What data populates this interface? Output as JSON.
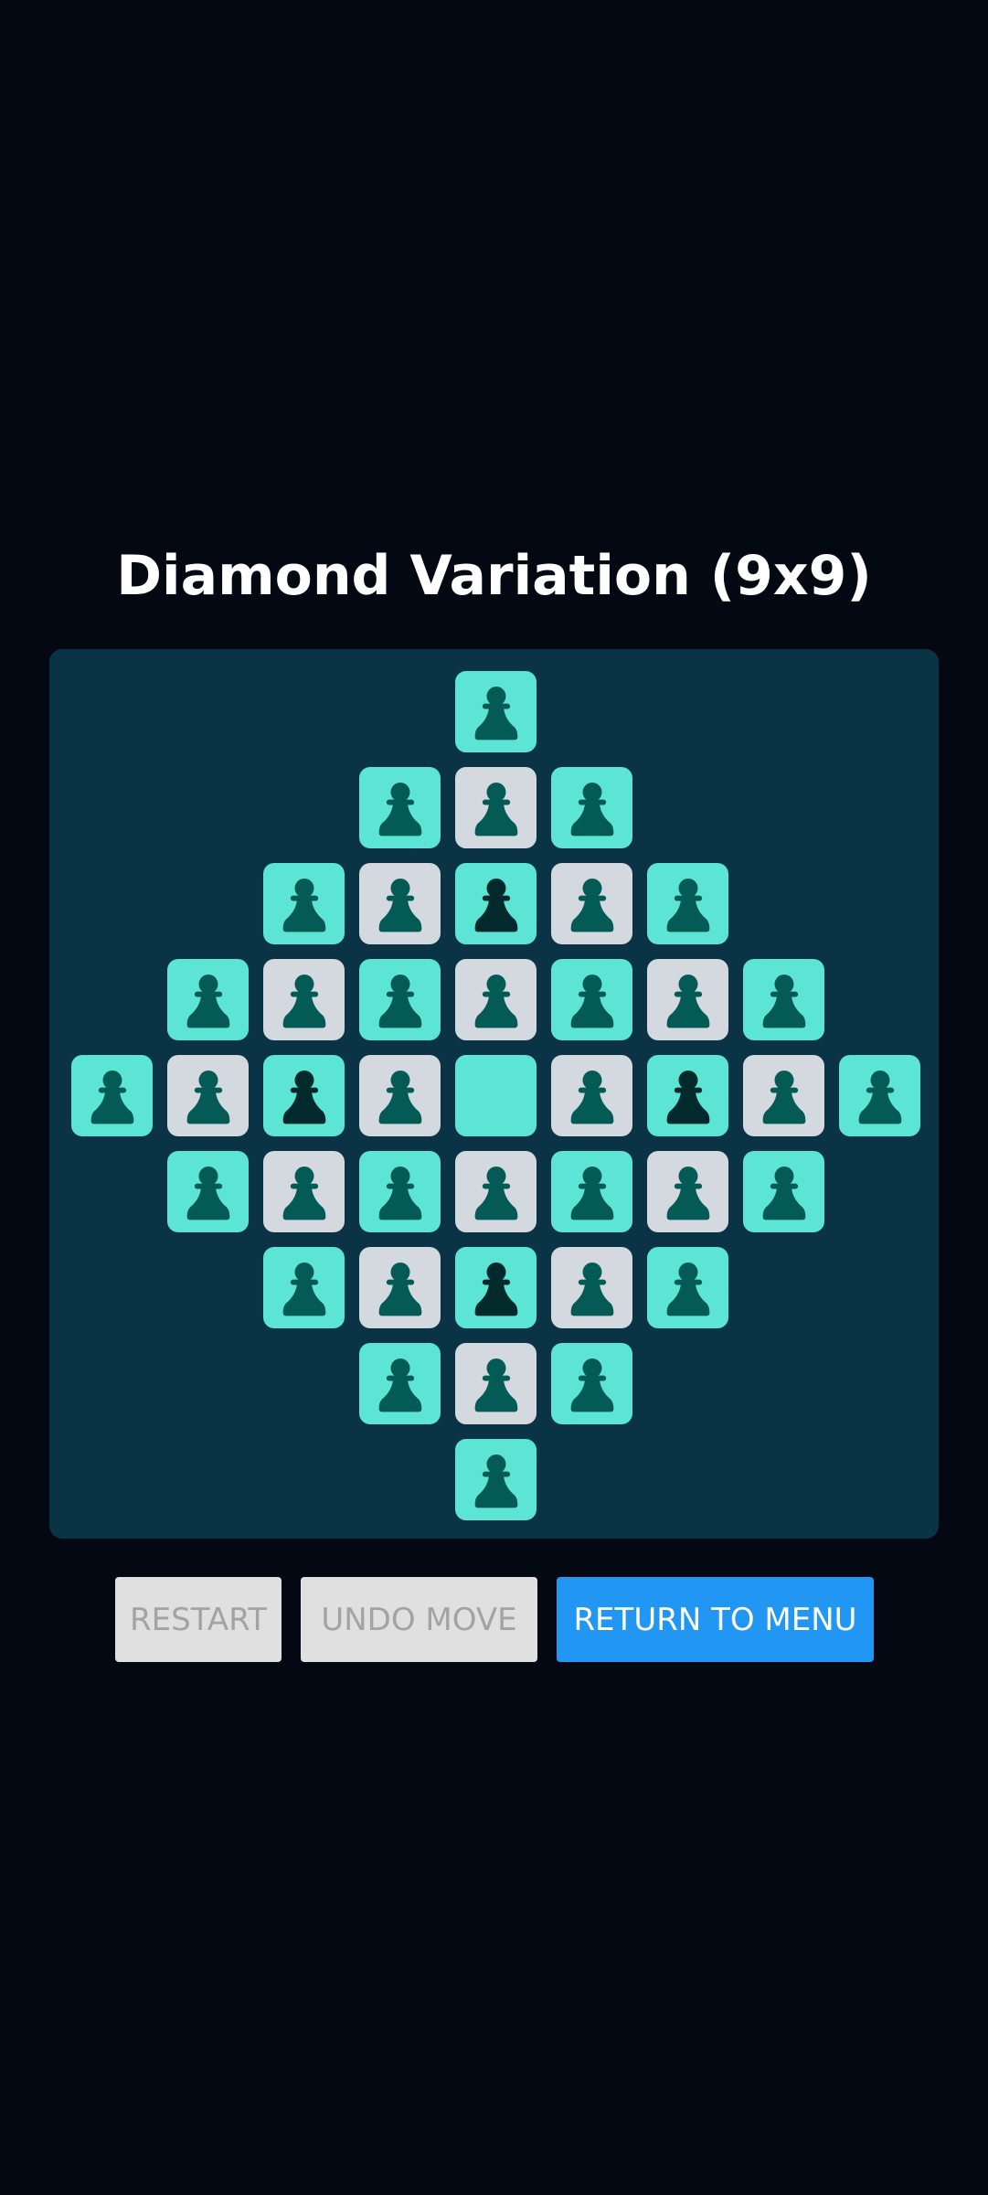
{
  "title": "Diamond Variation (9x9)",
  "board": {
    "size": 9,
    "cells": [
      {
        "row": 0,
        "col": 4,
        "bg": "teal",
        "piece": "normal"
      },
      {
        "row": 1,
        "col": 3,
        "bg": "teal",
        "piece": "normal"
      },
      {
        "row": 1,
        "col": 4,
        "bg": "gray",
        "piece": "normal"
      },
      {
        "row": 1,
        "col": 5,
        "bg": "teal",
        "piece": "normal"
      },
      {
        "row": 2,
        "col": 2,
        "bg": "teal",
        "piece": "normal"
      },
      {
        "row": 2,
        "col": 3,
        "bg": "gray",
        "piece": "normal"
      },
      {
        "row": 2,
        "col": 4,
        "bg": "teal",
        "piece": "dark"
      },
      {
        "row": 2,
        "col": 5,
        "bg": "gray",
        "piece": "normal"
      },
      {
        "row": 2,
        "col": 6,
        "bg": "teal",
        "piece": "normal"
      },
      {
        "row": 3,
        "col": 1,
        "bg": "teal",
        "piece": "normal"
      },
      {
        "row": 3,
        "col": 2,
        "bg": "gray",
        "piece": "normal"
      },
      {
        "row": 3,
        "col": 3,
        "bg": "teal",
        "piece": "normal"
      },
      {
        "row": 3,
        "col": 4,
        "bg": "gray",
        "piece": "normal"
      },
      {
        "row": 3,
        "col": 5,
        "bg": "teal",
        "piece": "normal"
      },
      {
        "row": 3,
        "col": 6,
        "bg": "gray",
        "piece": "normal"
      },
      {
        "row": 3,
        "col": 7,
        "bg": "teal",
        "piece": "normal"
      },
      {
        "row": 4,
        "col": 0,
        "bg": "teal",
        "piece": "normal"
      },
      {
        "row": 4,
        "col": 1,
        "bg": "gray",
        "piece": "normal"
      },
      {
        "row": 4,
        "col": 2,
        "bg": "teal",
        "piece": "dark"
      },
      {
        "row": 4,
        "col": 3,
        "bg": "gray",
        "piece": "normal"
      },
      {
        "row": 4,
        "col": 4,
        "bg": "teal",
        "piece": "none"
      },
      {
        "row": 4,
        "col": 5,
        "bg": "gray",
        "piece": "normal"
      },
      {
        "row": 4,
        "col": 6,
        "bg": "teal",
        "piece": "dark"
      },
      {
        "row": 4,
        "col": 7,
        "bg": "gray",
        "piece": "normal"
      },
      {
        "row": 4,
        "col": 8,
        "bg": "teal",
        "piece": "normal"
      },
      {
        "row": 5,
        "col": 1,
        "bg": "teal",
        "piece": "normal"
      },
      {
        "row": 5,
        "col": 2,
        "bg": "gray",
        "piece": "normal"
      },
      {
        "row": 5,
        "col": 3,
        "bg": "teal",
        "piece": "normal"
      },
      {
        "row": 5,
        "col": 4,
        "bg": "gray",
        "piece": "normal"
      },
      {
        "row": 5,
        "col": 5,
        "bg": "teal",
        "piece": "normal"
      },
      {
        "row": 5,
        "col": 6,
        "bg": "gray",
        "piece": "normal"
      },
      {
        "row": 5,
        "col": 7,
        "bg": "teal",
        "piece": "normal"
      },
      {
        "row": 6,
        "col": 2,
        "bg": "teal",
        "piece": "normal"
      },
      {
        "row": 6,
        "col": 3,
        "bg": "gray",
        "piece": "normal"
      },
      {
        "row": 6,
        "col": 4,
        "bg": "teal",
        "piece": "dark"
      },
      {
        "row": 6,
        "col": 5,
        "bg": "gray",
        "piece": "normal"
      },
      {
        "row": 6,
        "col": 6,
        "bg": "teal",
        "piece": "normal"
      },
      {
        "row": 7,
        "col": 3,
        "bg": "teal",
        "piece": "normal"
      },
      {
        "row": 7,
        "col": 4,
        "bg": "gray",
        "piece": "normal"
      },
      {
        "row": 7,
        "col": 5,
        "bg": "teal",
        "piece": "normal"
      },
      {
        "row": 8,
        "col": 4,
        "bg": "teal",
        "piece": "normal"
      }
    ]
  },
  "colors": {
    "page_bg": "#040813",
    "board_bg": "#0a3346",
    "cell_teal": "#5ce5d4",
    "cell_gray": "#d4d8df",
    "piece_normal": "#045a55",
    "piece_dark": "#022a2d",
    "button_primary": "#2196f3",
    "button_disabled": "#e0e0e0"
  },
  "buttons": {
    "restart": {
      "label": "RESTART",
      "enabled": false
    },
    "undo": {
      "label": "UNDO MOVE",
      "enabled": false
    },
    "menu": {
      "label": "RETURN TO MENU",
      "enabled": true
    }
  }
}
